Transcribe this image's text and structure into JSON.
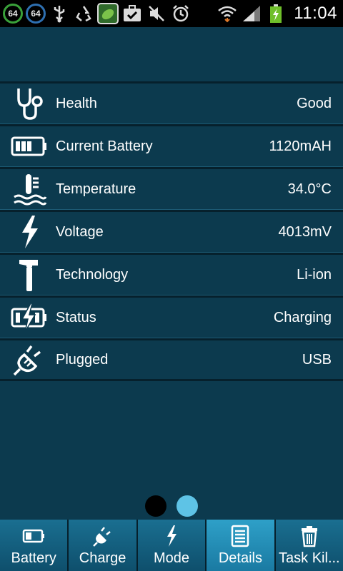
{
  "status_bar": {
    "badge1": "64",
    "badge2": "64",
    "time": "11:04"
  },
  "rows": [
    {
      "icon": "stethoscope-icon",
      "label": "Health",
      "value": "Good"
    },
    {
      "icon": "battery-icon",
      "label": "Current Battery",
      "value": "1120mAH"
    },
    {
      "icon": "thermometer-icon",
      "label": "Temperature",
      "value": "34.0°C"
    },
    {
      "icon": "lightning-icon",
      "label": "Voltage",
      "value": "4013mV"
    },
    {
      "icon": "hammer-icon",
      "label": "Technology",
      "value": "Li-ion"
    },
    {
      "icon": "charging-battery-icon",
      "label": "Status",
      "value": "Charging"
    },
    {
      "icon": "plug-icon",
      "label": "Plugged",
      "value": "USB"
    }
  ],
  "pager": {
    "active_index": 1,
    "count": 2
  },
  "tabs": [
    {
      "icon": "battery-icon",
      "label": "Battery"
    },
    {
      "icon": "plug-icon",
      "label": "Charge"
    },
    {
      "icon": "lightning-icon",
      "label": "Mode"
    },
    {
      "icon": "document-icon",
      "label": "Details",
      "selected": true
    },
    {
      "icon": "trash-icon",
      "label": "Task Kil..."
    }
  ],
  "colors": {
    "background": "#0c3a4e",
    "tab": "#1a6f91",
    "tab_selected": "#2ea0c8",
    "dot_active": "#5ec3e6"
  }
}
